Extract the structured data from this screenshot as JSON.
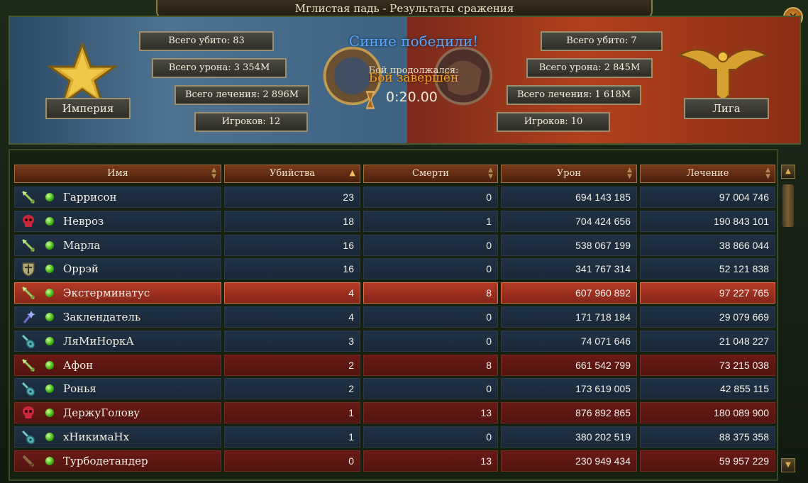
{
  "window": {
    "title": "Мглистая падь - Результаты сражения",
    "close_label": "✕"
  },
  "result": {
    "victory_text": "Синие победили!",
    "status_duration_label": "Бой продолжался:",
    "status_label": "Бой завершён",
    "timer": "0:20.00"
  },
  "teams": {
    "left": {
      "name": "Империя",
      "kills": "Всего убито: 83",
      "damage": "Всего урона: 3 354M",
      "healing": "Всего лечения: 2 896M",
      "players": "Игроков: 12",
      "color": "#4f7493"
    },
    "right": {
      "name": "Лига",
      "kills": "Всего убито: 7",
      "damage": "Всего урона: 2 845M",
      "healing": "Всего лечения: 1 618M",
      "players": "Игроков: 10",
      "color": "#b2401c"
    }
  },
  "table": {
    "columns": [
      "Имя",
      "Убийства",
      "Смерти",
      "Урон",
      "Лечение"
    ],
    "sort_column": "Убийства",
    "rows": [
      {
        "icon": "sword-arrow-icon",
        "name": "Гаррисон",
        "kills": "23",
        "deaths": "0",
        "damage": "694 143 185",
        "healing": "97 004 746",
        "team": "blue"
      },
      {
        "icon": "skull-icon",
        "name": "Невроз",
        "kills": "18",
        "deaths": "1",
        "damage": "704 424 656",
        "healing": "190 843 101",
        "team": "blue"
      },
      {
        "icon": "sword-arrow-icon",
        "name": "Марла",
        "kills": "16",
        "deaths": "0",
        "damage": "538 067 199",
        "healing": "38 866 044",
        "team": "blue"
      },
      {
        "icon": "shield-icon",
        "name": "Оррэй",
        "kills": "16",
        "deaths": "0",
        "damage": "341 767 314",
        "healing": "52 121 838",
        "team": "blue"
      },
      {
        "icon": "sword-arrow-icon",
        "name": "Экстерминатус",
        "kills": "4",
        "deaths": "8",
        "damage": "607 960 892",
        "healing": "97 227 765",
        "team": "highlight"
      },
      {
        "icon": "magic-staff-icon",
        "name": "Заклендатель",
        "kills": "4",
        "deaths": "0",
        "damage": "171 718 184",
        "healing": "29 079 669",
        "team": "blue"
      },
      {
        "icon": "lute-icon",
        "name": "ЛяМиНоркА",
        "kills": "3",
        "deaths": "0",
        "damage": "74 071 646",
        "healing": "21 048 227",
        "team": "blue"
      },
      {
        "icon": "sword-arrow-icon",
        "name": "Афон",
        "kills": "2",
        "deaths": "8",
        "damage": "661 542 799",
        "healing": "73 215 038",
        "team": "red"
      },
      {
        "icon": "lute-icon",
        "name": "Ронья",
        "kills": "2",
        "deaths": "0",
        "damage": "173 619 005",
        "healing": "42 855 115",
        "team": "blue"
      },
      {
        "icon": "skull-icon",
        "name": "ДержуГолову",
        "kills": "1",
        "deaths": "13",
        "damage": "876 892 865",
        "healing": "180 089 900",
        "team": "red"
      },
      {
        "icon": "lute-icon",
        "name": "хНикимаНх",
        "kills": "1",
        "deaths": "0",
        "damage": "380 202 519",
        "healing": "88 375 358",
        "team": "blue"
      },
      {
        "icon": "sword-icon",
        "name": "Турбодетандер",
        "kills": "0",
        "deaths": "13",
        "damage": "230 949 434",
        "healing": "59 957 229",
        "team": "red"
      }
    ]
  },
  "scrollbar": {
    "up_label": "▲",
    "down_label": "▼"
  }
}
